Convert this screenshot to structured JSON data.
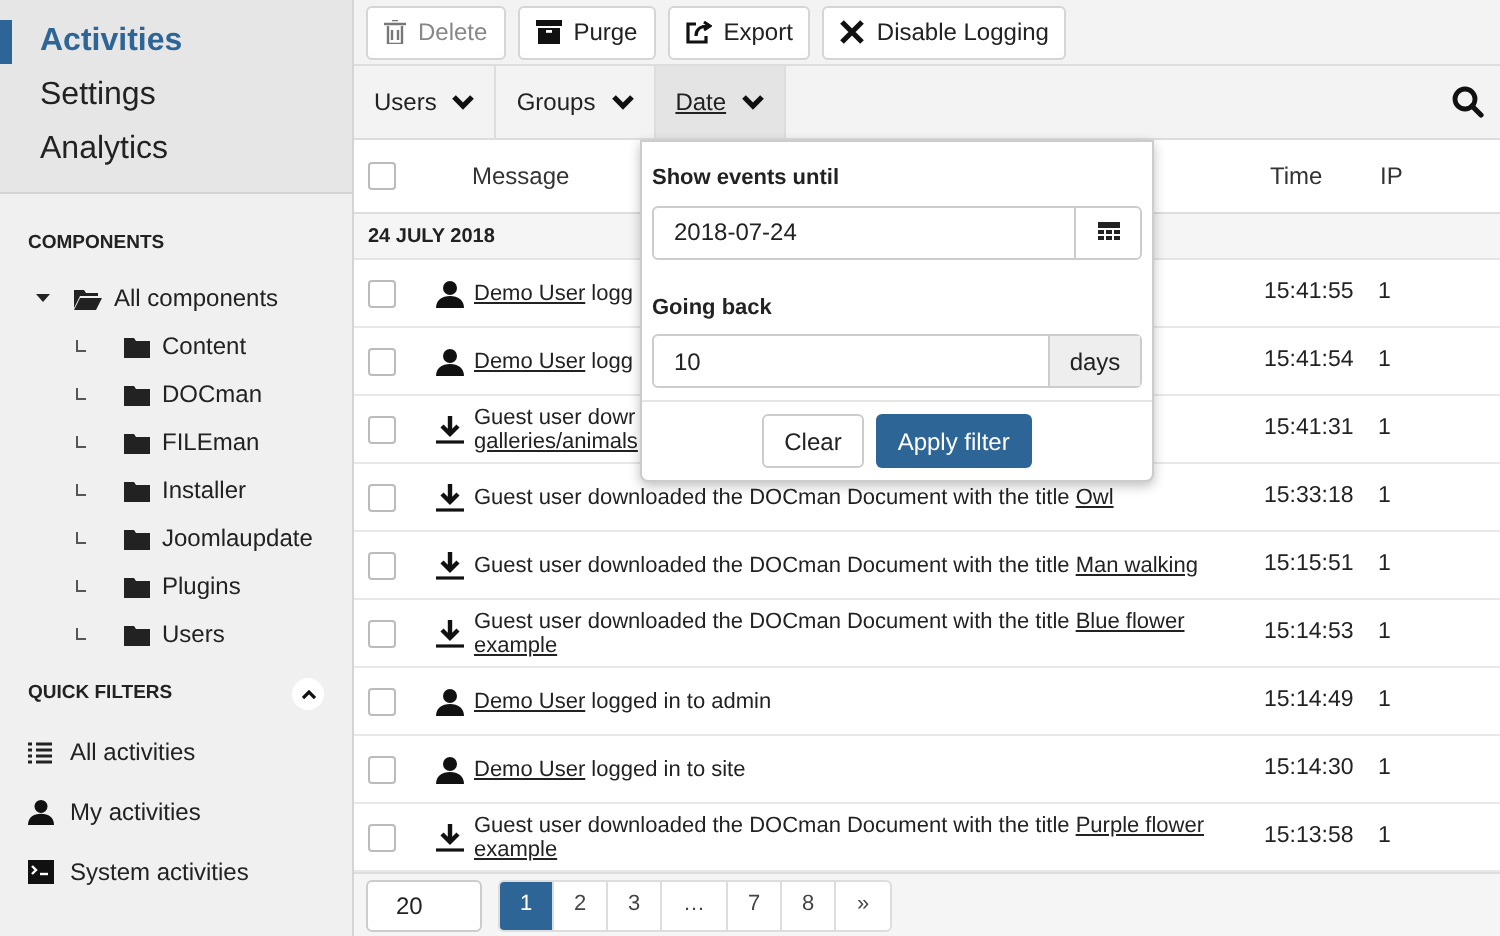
{
  "nav": [
    {
      "label": "Activities",
      "selected": true
    },
    {
      "label": "Settings",
      "selected": false
    },
    {
      "label": "Analytics",
      "selected": false
    }
  ],
  "components": {
    "heading": "COMPONENTS",
    "tree": [
      {
        "label": "All components",
        "expanded": true,
        "children": [
          {
            "label": "Content"
          },
          {
            "label": "DOCman"
          },
          {
            "label": "FILEman"
          },
          {
            "label": "Installer"
          },
          {
            "label": "Joomlaupdate"
          },
          {
            "label": "Plugins"
          },
          {
            "label": "Users"
          }
        ]
      }
    ]
  },
  "quick_filters": {
    "heading": "QUICK FILTERS",
    "expanded": true,
    "items": [
      {
        "kind": "list",
        "label": "All activities"
      },
      {
        "kind": "user",
        "label": "My activities"
      },
      {
        "kind": "terminal",
        "label": "System activities"
      }
    ]
  },
  "toolbar": [
    {
      "kind": "trash",
      "label": "Delete",
      "disabled": true
    },
    {
      "kind": "box",
      "label": "Purge",
      "disabled": false
    },
    {
      "kind": "export",
      "label": "Export",
      "disabled": false
    },
    {
      "kind": "cross",
      "label": "Disable Logging",
      "disabled": false
    }
  ],
  "filters": [
    {
      "label": "Users",
      "selected": false
    },
    {
      "label": "Groups",
      "selected": false
    },
    {
      "label": "Date",
      "selected": true
    }
  ],
  "date_filter": {
    "until_label": "Show events until",
    "until_value": "2018-07-24",
    "back_label": "Going back",
    "back_value": "10",
    "back_unit": "days",
    "clear": "Clear",
    "apply": "Apply filter"
  },
  "table": {
    "select_all_checked": false,
    "columns": [
      "Message",
      "Time",
      "IP"
    ],
    "group": "24 JULY 2018",
    "rows": [
      {
        "kind": "user",
        "checked": false,
        "lines": [
          [
            {
              "text": "Demo User",
              "link": true
            },
            {
              "text": " logg",
              "link": false
            }
          ]
        ],
        "time": "15:41:55",
        "ip": "1"
      },
      {
        "kind": "user",
        "checked": false,
        "lines": [
          [
            {
              "text": "Demo User",
              "link": true
            },
            {
              "text": " logg",
              "link": false
            }
          ]
        ],
        "time": "15:41:54",
        "ip": "1"
      },
      {
        "kind": "download",
        "checked": false,
        "lines": [
          [
            {
              "text": "Guest user dowr",
              "link": false
            }
          ],
          [
            {
              "text": "galleries/animals",
              "link": true
            }
          ]
        ],
        "time": "15:41:31",
        "ip": "1"
      },
      {
        "kind": "download",
        "checked": false,
        "lines": [
          [
            {
              "text": "Guest user downloaded the DOCman Document with the title ",
              "link": false
            },
            {
              "text": "Owl",
              "link": true
            }
          ]
        ],
        "time": "15:33:18",
        "ip": "1"
      },
      {
        "kind": "download",
        "checked": false,
        "lines": [
          [
            {
              "text": "Guest user downloaded the DOCman Document with the title ",
              "link": false
            },
            {
              "text": "Man walking",
              "link": true
            }
          ]
        ],
        "time": "15:15:51",
        "ip": "1"
      },
      {
        "kind": "download",
        "checked": false,
        "lines": [
          [
            {
              "text": "Guest user downloaded the DOCman Document with the title ",
              "link": false
            },
            {
              "text": "Blue flower",
              "link": true
            }
          ],
          [
            {
              "text": "example",
              "link": true
            }
          ]
        ],
        "time": "15:14:53",
        "ip": "1"
      },
      {
        "kind": "user",
        "checked": false,
        "lines": [
          [
            {
              "text": "Demo User",
              "link": true
            },
            {
              "text": " logged in to admin",
              "link": false
            }
          ]
        ],
        "time": "15:14:49",
        "ip": "1"
      },
      {
        "kind": "user",
        "checked": false,
        "lines": [
          [
            {
              "text": "Demo User",
              "link": true
            },
            {
              "text": " logged in to site",
              "link": false
            }
          ]
        ],
        "time": "15:14:30",
        "ip": "1"
      },
      {
        "kind": "download",
        "checked": false,
        "lines": [
          [
            {
              "text": "Guest user downloaded the DOCman Document with the title ",
              "link": false
            },
            {
              "text": "Purple flower",
              "link": true
            }
          ],
          [
            {
              "text": "example",
              "link": true
            }
          ]
        ],
        "time": "15:13:58",
        "ip": "1"
      }
    ]
  },
  "footer": {
    "limit": "20",
    "pages": [
      {
        "label": "1",
        "selected": true
      },
      {
        "label": "2",
        "selected": false
      },
      {
        "label": "3",
        "selected": false
      },
      {
        "label": "…",
        "selected": false
      },
      {
        "label": "7",
        "selected": false
      },
      {
        "label": "8",
        "selected": false
      },
      {
        "label": "»",
        "selected": false
      }
    ]
  }
}
